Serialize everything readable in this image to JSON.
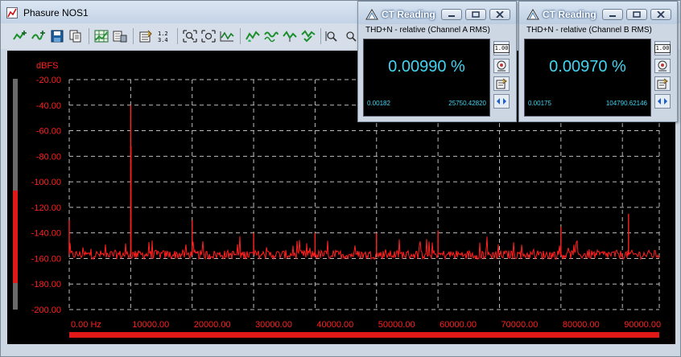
{
  "window": {
    "title": "Phasure NOS1"
  },
  "toolbar": {
    "buttons": [
      "add-trace-icon",
      "add-curve-icon",
      "save-icon",
      "copy-icon",
      "grid-icon",
      "print-preview-icon",
      "properties-icon",
      "numeric-icon",
      "zoom-in-icon",
      "zoom-fit-icon",
      "waveform-icon",
      "cursor-up-icon",
      "cursor-wave-icon",
      "cursor-peak-icon",
      "cursor-check-icon",
      "zoom-x-icon",
      "zoom-y-icon"
    ]
  },
  "colors": {
    "trace": "#ff2020",
    "axis_label": "#ff2020",
    "grid": "#bbbbbb",
    "readout": "#42d5f2"
  },
  "chart_data": {
    "type": "line",
    "title": "",
    "ylabel": "dBFS",
    "xlabel": "",
    "x_unit_first_tick": "0.00 Hz",
    "xlim": [
      0,
      96000
    ],
    "ylim": [
      -200,
      -20
    ],
    "y_ticks": [
      "-20.00",
      "-40.00",
      "-60.00",
      "-80.00",
      "-100.00",
      "-120.00",
      "-140.00",
      "-160.00",
      "-180.00",
      "-200.00"
    ],
    "y_tick_values": [
      -20,
      -40,
      -60,
      -80,
      -100,
      -120,
      -140,
      -160,
      -180,
      -200
    ],
    "x_ticks": [
      "0.00 Hz",
      "10000.00",
      "20000.00",
      "30000.00",
      "40000.00",
      "50000.00",
      "60000.00",
      "70000.00",
      "80000.00",
      "90000.00"
    ],
    "x_tick_values": [
      0,
      10000,
      20000,
      30000,
      40000,
      50000,
      60000,
      70000,
      80000,
      90000
    ],
    "grid": true,
    "noise_floor_db": -157,
    "series": [
      {
        "peaks": [
          {
            "x": 0,
            "y": -130
          },
          {
            "x": 10000,
            "y": -40
          },
          {
            "x": 10050,
            "y": -72
          },
          {
            "x": 20000,
            "y": -130
          },
          {
            "x": 30000,
            "y": -140
          },
          {
            "x": 40000,
            "y": -140
          },
          {
            "x": 50000,
            "y": -140
          },
          {
            "x": 60000,
            "y": -138
          },
          {
            "x": 80000,
            "y": -135
          },
          {
            "x": 91000,
            "y": -125
          }
        ]
      }
    ]
  },
  "ct_readings": [
    {
      "title": "CT Reading",
      "subtitle": "THD+N - relative (Channel A RMS)",
      "value": "0.00990 %",
      "min": "0.00182",
      "max": "25750.42820",
      "decimal_label": "1.00"
    },
    {
      "title": "CT Reading",
      "subtitle": "THD+N - relative (Channel B RMS)",
      "value": "0.00970 %",
      "min": "0.00175",
      "max": "104790.62146",
      "decimal_label": "1.00"
    }
  ]
}
